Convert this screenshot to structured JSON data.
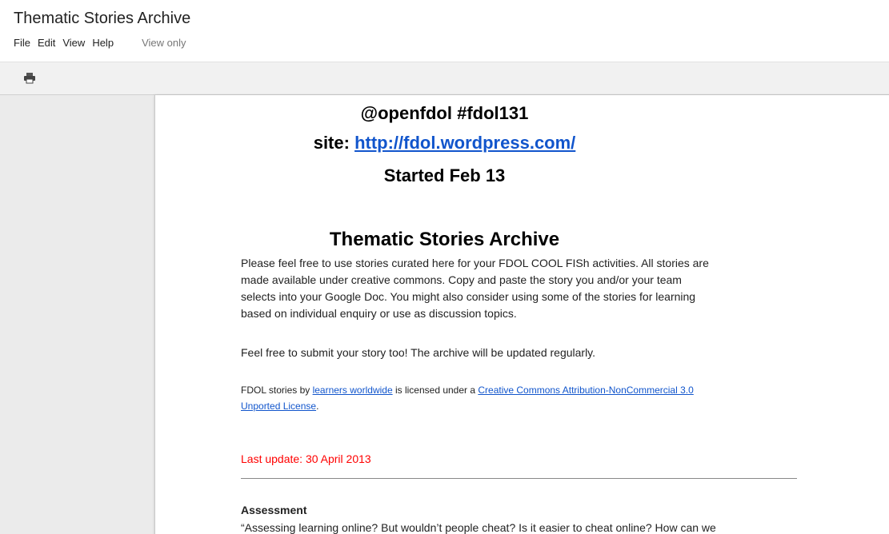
{
  "window": {
    "title": "Thematic Stories Archive"
  },
  "menubar": {
    "items": [
      "File",
      "Edit",
      "View",
      "Help"
    ],
    "view_only": "View only"
  },
  "toolbar": {
    "print_icon": "print-icon"
  },
  "document": {
    "handle": "@openfdol #fdol131",
    "site_prefix": "site: ",
    "site_link": "http://fdol.wordpress.com/",
    "started": "Started Feb 13",
    "heading": "Thematic Stories Archive",
    "intro_lines": [
      "Please feel free to use stories curated here for your FDOL COOL FISh activities. All stories are",
      "made available under creative commons. Copy and paste the story you and/or your team",
      "selects into your Google Doc. You might also consider using some of the stories for learning",
      "based on individual enquiry or use as discussion topics."
    ],
    "submit_note": "Feel free to submit your story too! The archive will be updated regularly.",
    "license": {
      "prefix": "FDOL stories by ",
      "author_link": "learners worldwide",
      "middle": " is licensed under a ",
      "license_link_line1": "Creative Commons Attribution-NonCommercial 3.0",
      "license_link_line2": "Unported License",
      "suffix": "."
    },
    "last_update": "Last update: 30 April 2013",
    "section_title": "Assessment",
    "section_first_line": "“Assessing learning online? But wouldn’t people cheat? Is it easier to cheat online? How can we"
  },
  "colors": {
    "link": "#1155cc",
    "last_update": "#ff0000",
    "canvas_bg": "#ebebeb",
    "toolbar_bg": "#f1f1f1"
  }
}
